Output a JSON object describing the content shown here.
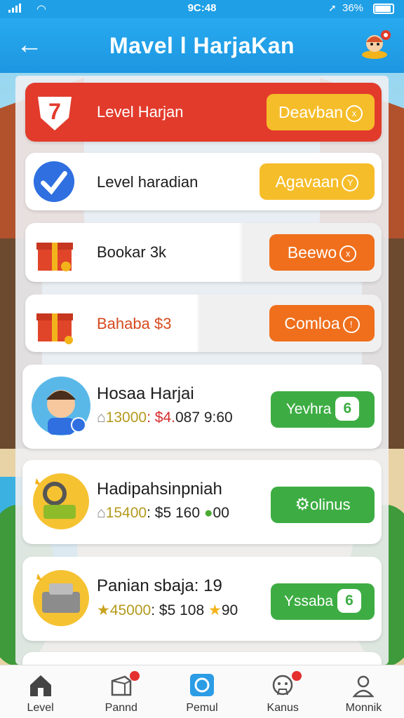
{
  "status": {
    "time": "9C:48",
    "battery": "36%"
  },
  "header": {
    "title": "Mavel l HarjaKan",
    "back_icon": "arrow-left-icon",
    "avatar_icon": "character-avatar-icon"
  },
  "rows": [
    {
      "label": "Level Harjan",
      "action": "Deavban",
      "action_glyph": "x",
      "icon": "red-shield-7-icon",
      "badge_text": "7"
    },
    {
      "label": "Level haradian",
      "action": "Agavaan",
      "action_glyph": "Y",
      "icon": "blue-check-icon"
    },
    {
      "label": "Bookar 3k",
      "action": "Beewo",
      "action_glyph": "x",
      "icon": "gift-box-icon"
    },
    {
      "label": "Bahaba $3",
      "action": "Comloa",
      "action_glyph": "!",
      "icon": "gift-box-icon"
    },
    {
      "label": "Hosaa Harjai",
      "stat1": "13000",
      "stat2": ": $4.",
      "stat3": "087 9:60",
      "action": "Yevhra",
      "pill": "6",
      "icon": "boy-avatar-icon"
    },
    {
      "label": "Hadipahsinpniah",
      "stat1": "15400",
      "stat2": ": $5 160",
      "stat3": "00",
      "action": "olinus",
      "icon": "yellow-item-icon"
    },
    {
      "label": "Panian sbaja: 19",
      "stat1": "45000",
      "stat2": ": $5 108",
      "stat3": "90",
      "action": "Yssaba",
      "pill": "6",
      "icon": "gray-box-icon"
    }
  ],
  "nav": [
    {
      "label": "Level",
      "icon": "home-icon"
    },
    {
      "label": "Pannd",
      "icon": "box-icon"
    },
    {
      "label": "Pemul",
      "icon": "chat-icon"
    },
    {
      "label": "Kanus",
      "icon": "face-icon"
    },
    {
      "label": "Monnik",
      "icon": "person-icon"
    }
  ],
  "colors": {
    "header": "#1d9be4",
    "yellow": "#f6bd2a",
    "orange": "#ef6f1c",
    "green": "#3dad43",
    "red": "#e23b2c"
  }
}
